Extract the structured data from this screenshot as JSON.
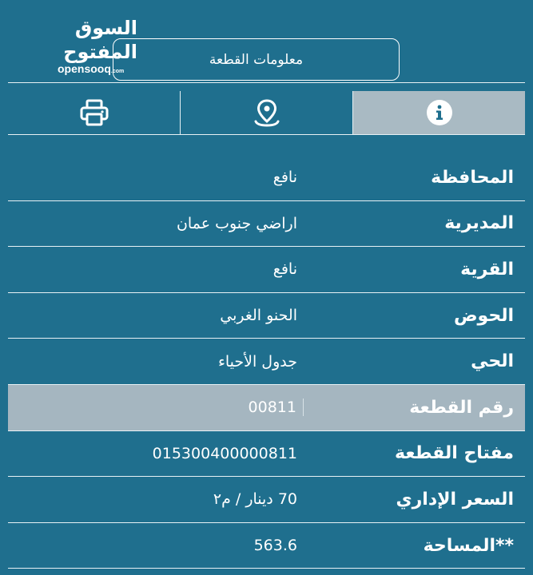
{
  "watermark": {
    "arabic": "السوق المفتوح",
    "english": "opensooq",
    "english_suffix": ".com"
  },
  "header": {
    "title": "معلومات القطعة"
  },
  "tabs": [
    {
      "icon": "info-icon",
      "active": true
    },
    {
      "icon": "map-pin-icon",
      "active": false
    },
    {
      "icon": "printer-icon",
      "active": false
    }
  ],
  "rows": [
    {
      "label": "المحافظة",
      "value": "نافع"
    },
    {
      "label": "المديرية",
      "value": "اراضي جنوب عمان"
    },
    {
      "label": "القرية",
      "value": "نافع"
    },
    {
      "label": "الحوض",
      "value": "الحنو الغربي"
    },
    {
      "label": "الحي",
      "value": "جدول الأحياء"
    },
    {
      "label": "رقم القطعة",
      "value": "00811"
    },
    {
      "label": "مفتاح القطعة",
      "value": "015300400000811"
    },
    {
      "label": "السعر الإداري",
      "value": "70 دينار / م٢"
    },
    {
      "label": "**المساحة",
      "value": "563.6"
    }
  ],
  "colors": {
    "background": "#1f6f8e",
    "active_tab": "#a9bac3",
    "highlight_row": "#a5b6c0",
    "line": "#e8f1f5"
  }
}
